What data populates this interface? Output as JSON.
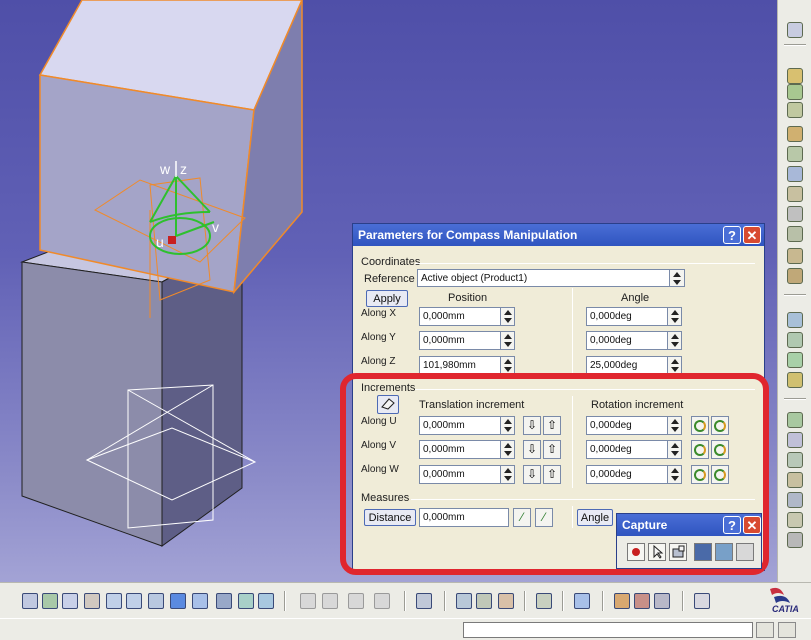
{
  "dialog": {
    "title": "Parameters for Compass Manipulation",
    "help_label": "?",
    "close_label": "✕",
    "coordinates": {
      "section_label": "Coordinates",
      "reference_label": "Reference",
      "reference_value": "Active object (Product1)",
      "apply_label": "Apply",
      "position_header": "Position",
      "angle_header": "Angle",
      "rows": [
        {
          "axis": "Along X",
          "position": "0,000mm",
          "angle": "0,000deg"
        },
        {
          "axis": "Along Y",
          "position": "0,000mm",
          "angle": "0,000deg"
        },
        {
          "axis": "Along Z",
          "position": "101,980mm",
          "angle": "25,000deg"
        }
      ]
    },
    "increments": {
      "section_label": "Increments",
      "translation_header": "Translation increment",
      "rotation_header": "Rotation increment",
      "rows": [
        {
          "axis": "Along U",
          "translation": "0,000mm",
          "rotation": "0,000deg"
        },
        {
          "axis": "Along V",
          "translation": "0,000mm",
          "rotation": "0,000deg"
        },
        {
          "axis": "Along W",
          "translation": "0,000mm",
          "rotation": "0,000deg"
        }
      ]
    },
    "measures": {
      "section_label": "Measures",
      "distance_label": "Distance",
      "distance_value": "0,000mm",
      "angle_label": "Angle"
    }
  },
  "capture": {
    "title": "Capture",
    "help_label": "?",
    "close_label": "✕"
  },
  "compass": {
    "w_label": "w",
    "z_label": "z",
    "v_label": "v",
    "u_label": "u"
  },
  "branding": {
    "logo_text": "CATIA"
  },
  "colors": {
    "highlight": "#e0262e",
    "title_bar": "#2f54c0",
    "dialog_bg": "#f0ecd8",
    "selection_edge": "#f08a2a",
    "compass": "#2ec02e"
  }
}
